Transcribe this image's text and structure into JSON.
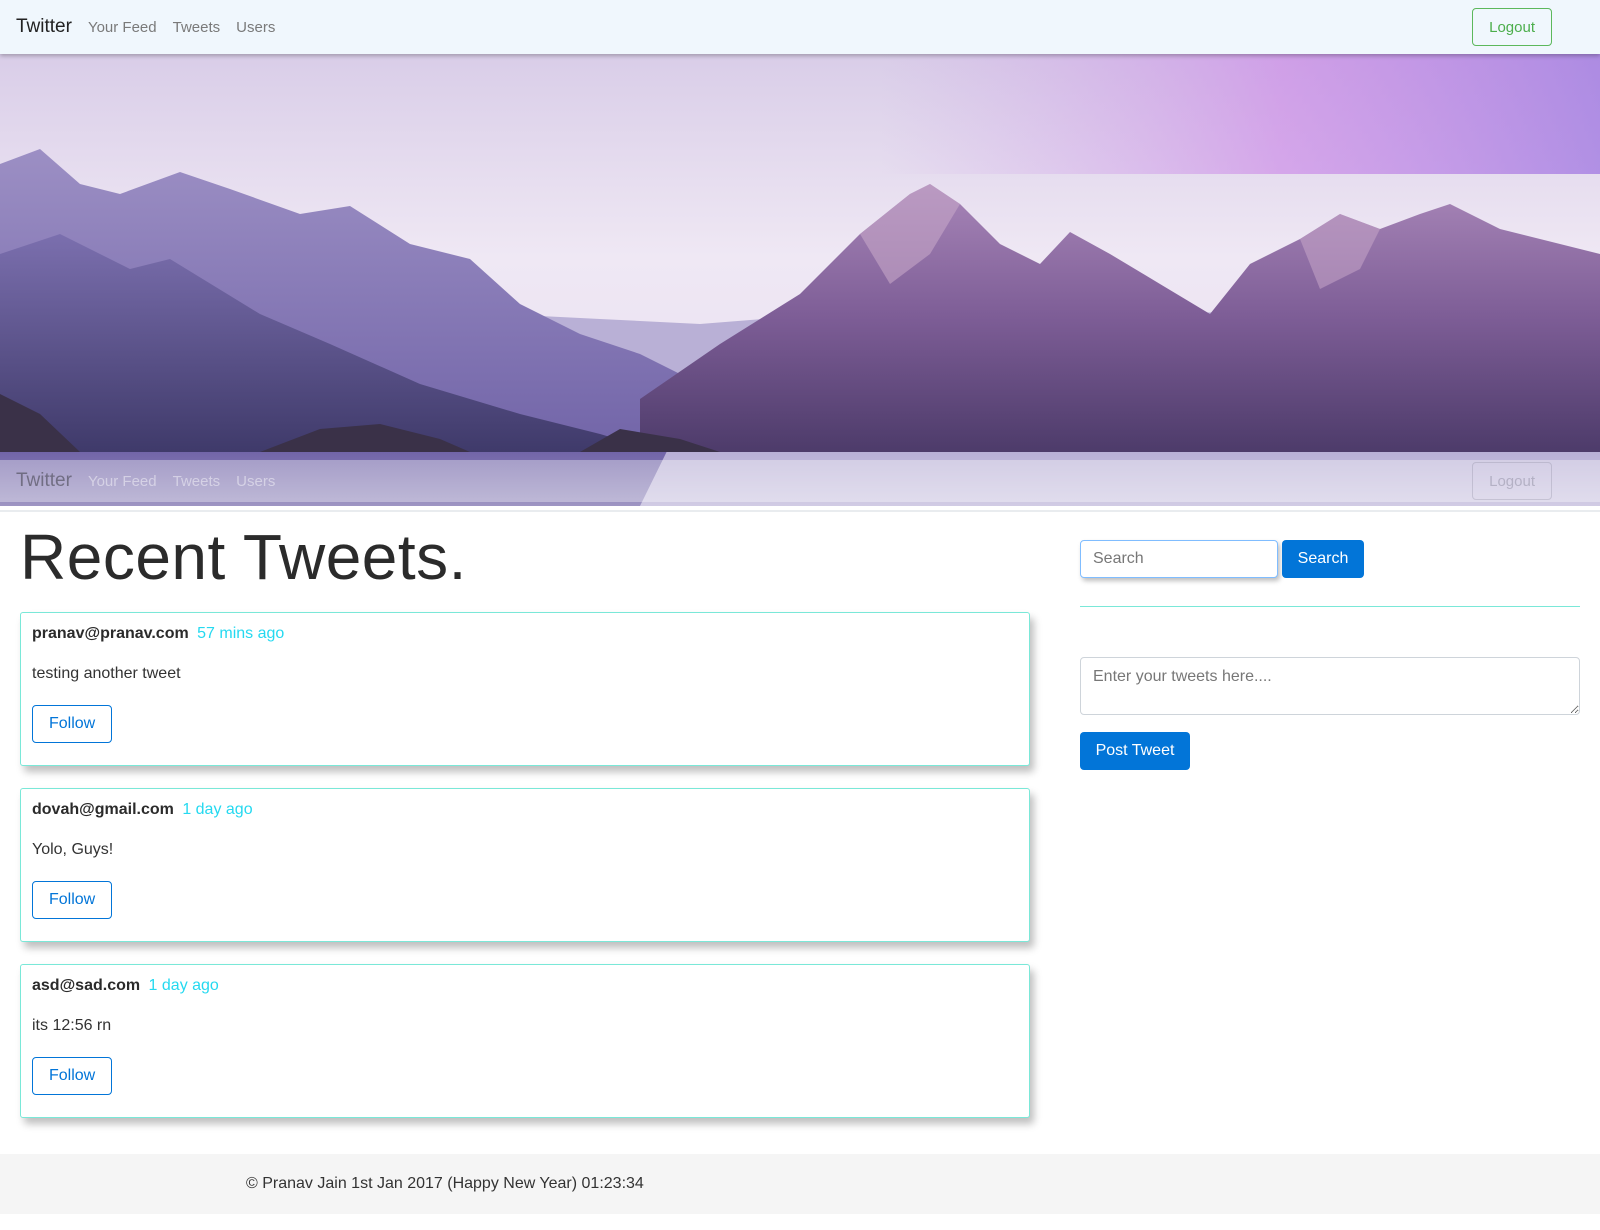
{
  "navbar": {
    "brand": "Twitter",
    "links": [
      "Your Feed",
      "Tweets",
      "Users"
    ],
    "logout_label": "Logout"
  },
  "hero": {
    "ghost_brand": "Twitter",
    "ghost_links": [
      "Your Feed",
      "Tweets",
      "Users"
    ],
    "ghost_logout": "Logout"
  },
  "main": {
    "title": "Recent Tweets.",
    "tweets": [
      {
        "author": "pranav@pranav.com",
        "time": "57 mins ago",
        "body": "testing another tweet",
        "follow_label": "Follow"
      },
      {
        "author": "dovah@gmail.com",
        "time": "1 day ago",
        "body": "Yolo, Guys!",
        "follow_label": "Follow"
      },
      {
        "author": "asd@sad.com",
        "time": "1 day ago",
        "body": "its 12:56 rn",
        "follow_label": "Follow"
      }
    ]
  },
  "sidebar": {
    "search_placeholder": "Search",
    "search_label": "Search",
    "tweet_placeholder": "Enter your tweets here....",
    "post_label": "Post Tweet"
  },
  "footer": {
    "text": "© Pranav Jain 1st Jan 2017 (Happy New Year) 01:23:34"
  },
  "colors": {
    "accent": "#0275d8",
    "logout": "#5cb85c",
    "card_border": "#7ae8d8",
    "timestamp": "#25d9f0"
  }
}
